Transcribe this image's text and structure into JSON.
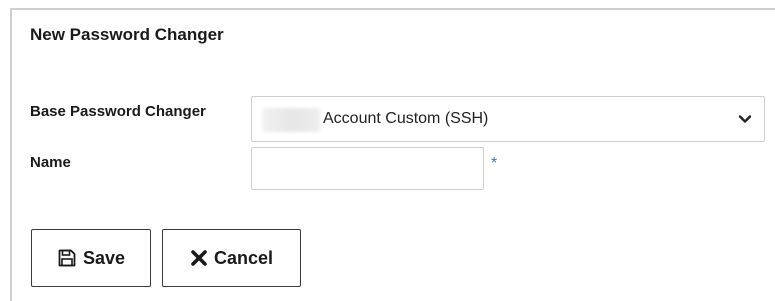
{
  "form": {
    "title": "New Password Changer",
    "base_label": "Base Password Changer",
    "base_value": "Account Custom (SSH)",
    "name_label": "Name",
    "name_value": "",
    "required_marker": "*"
  },
  "buttons": {
    "save_label": "Save",
    "cancel_label": "Cancel"
  },
  "icons": {
    "save": "floppy-disk-icon",
    "cancel": "x-icon",
    "select": "chevron-down-icon"
  },
  "colors": {
    "required": "#2b7cd3",
    "border": "#cfcfcf"
  }
}
